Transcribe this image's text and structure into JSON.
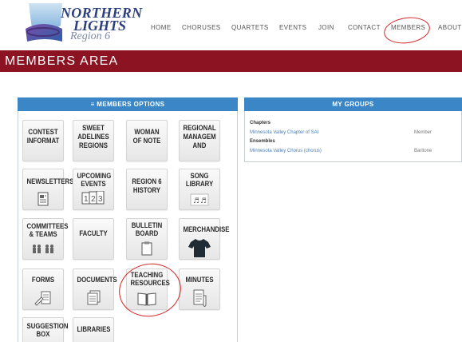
{
  "logo": {
    "line1": "NORTHERN",
    "line2": "LIGHTS",
    "line3": "Region 6"
  },
  "nav": [
    "HOME",
    "CHORUSES",
    "QUARTETS",
    "EVENTS",
    "JOIN",
    "CONTACT",
    "MEMBERS",
    "ABOUT"
  ],
  "banner": {
    "title": "MEMBERS AREA"
  },
  "members_options": {
    "title": "≡ MEMBERS OPTIONS",
    "tiles": [
      {
        "label": [
          "CONTEST",
          "INFORMAT"
        ],
        "icon": ""
      },
      {
        "label": [
          "SWEET",
          "ADELINES",
          "REGIONS"
        ],
        "icon": ""
      },
      {
        "label": [
          "WOMAN",
          "OF NOTE"
        ],
        "icon": ""
      },
      {
        "label": [
          "REGIONAL",
          "MANAGEM",
          "AND"
        ],
        "icon": ""
      },
      {
        "label": [
          "NEWSLETTERS"
        ],
        "icon": "newsletter-icon"
      },
      {
        "label": [
          "UPCOMING",
          "EVENTS"
        ],
        "icon": "calendar-icon"
      },
      {
        "label": [
          "REGION 6",
          "HISTORY"
        ],
        "icon": ""
      },
      {
        "label": [
          "SONG",
          "LIBRARY"
        ],
        "icon": "music-notes-icon"
      },
      {
        "label": [
          "COMMITTEES",
          "& TEAMS"
        ],
        "icon": "people-icon"
      },
      {
        "label": [
          "FACULTY"
        ],
        "icon": ""
      },
      {
        "label": [
          "BULLETIN",
          "BOARD"
        ],
        "icon": "clipboard-icon"
      },
      {
        "label": [
          "MERCHANDISE"
        ],
        "icon": "tshirt-icon"
      },
      {
        "label": [
          "FORMS"
        ],
        "icon": "forms-icon"
      },
      {
        "label": [
          "DOCUMENTS"
        ],
        "icon": "documents-icon"
      },
      {
        "label": [
          "TEACHING",
          "RESOURCES"
        ],
        "icon": "book-icon"
      },
      {
        "label": [
          "MINUTES"
        ],
        "icon": "minutes-icon"
      },
      {
        "label": [
          "SUGGESTION",
          "BOX"
        ],
        "icon": ""
      },
      {
        "label": [
          "LIBRARIES"
        ],
        "icon": ""
      }
    ]
  },
  "my_groups": {
    "title": "MY GROUPS",
    "chapters_label": "Chapters",
    "chapter_name": "Minnesota Valley Chapter of SAI",
    "chapter_role": "Member",
    "ensembles_label": "Ensembles",
    "ensemble_name": "Minnesota Valley Chorus (chorus)",
    "ensemble_role": "Baritone"
  }
}
